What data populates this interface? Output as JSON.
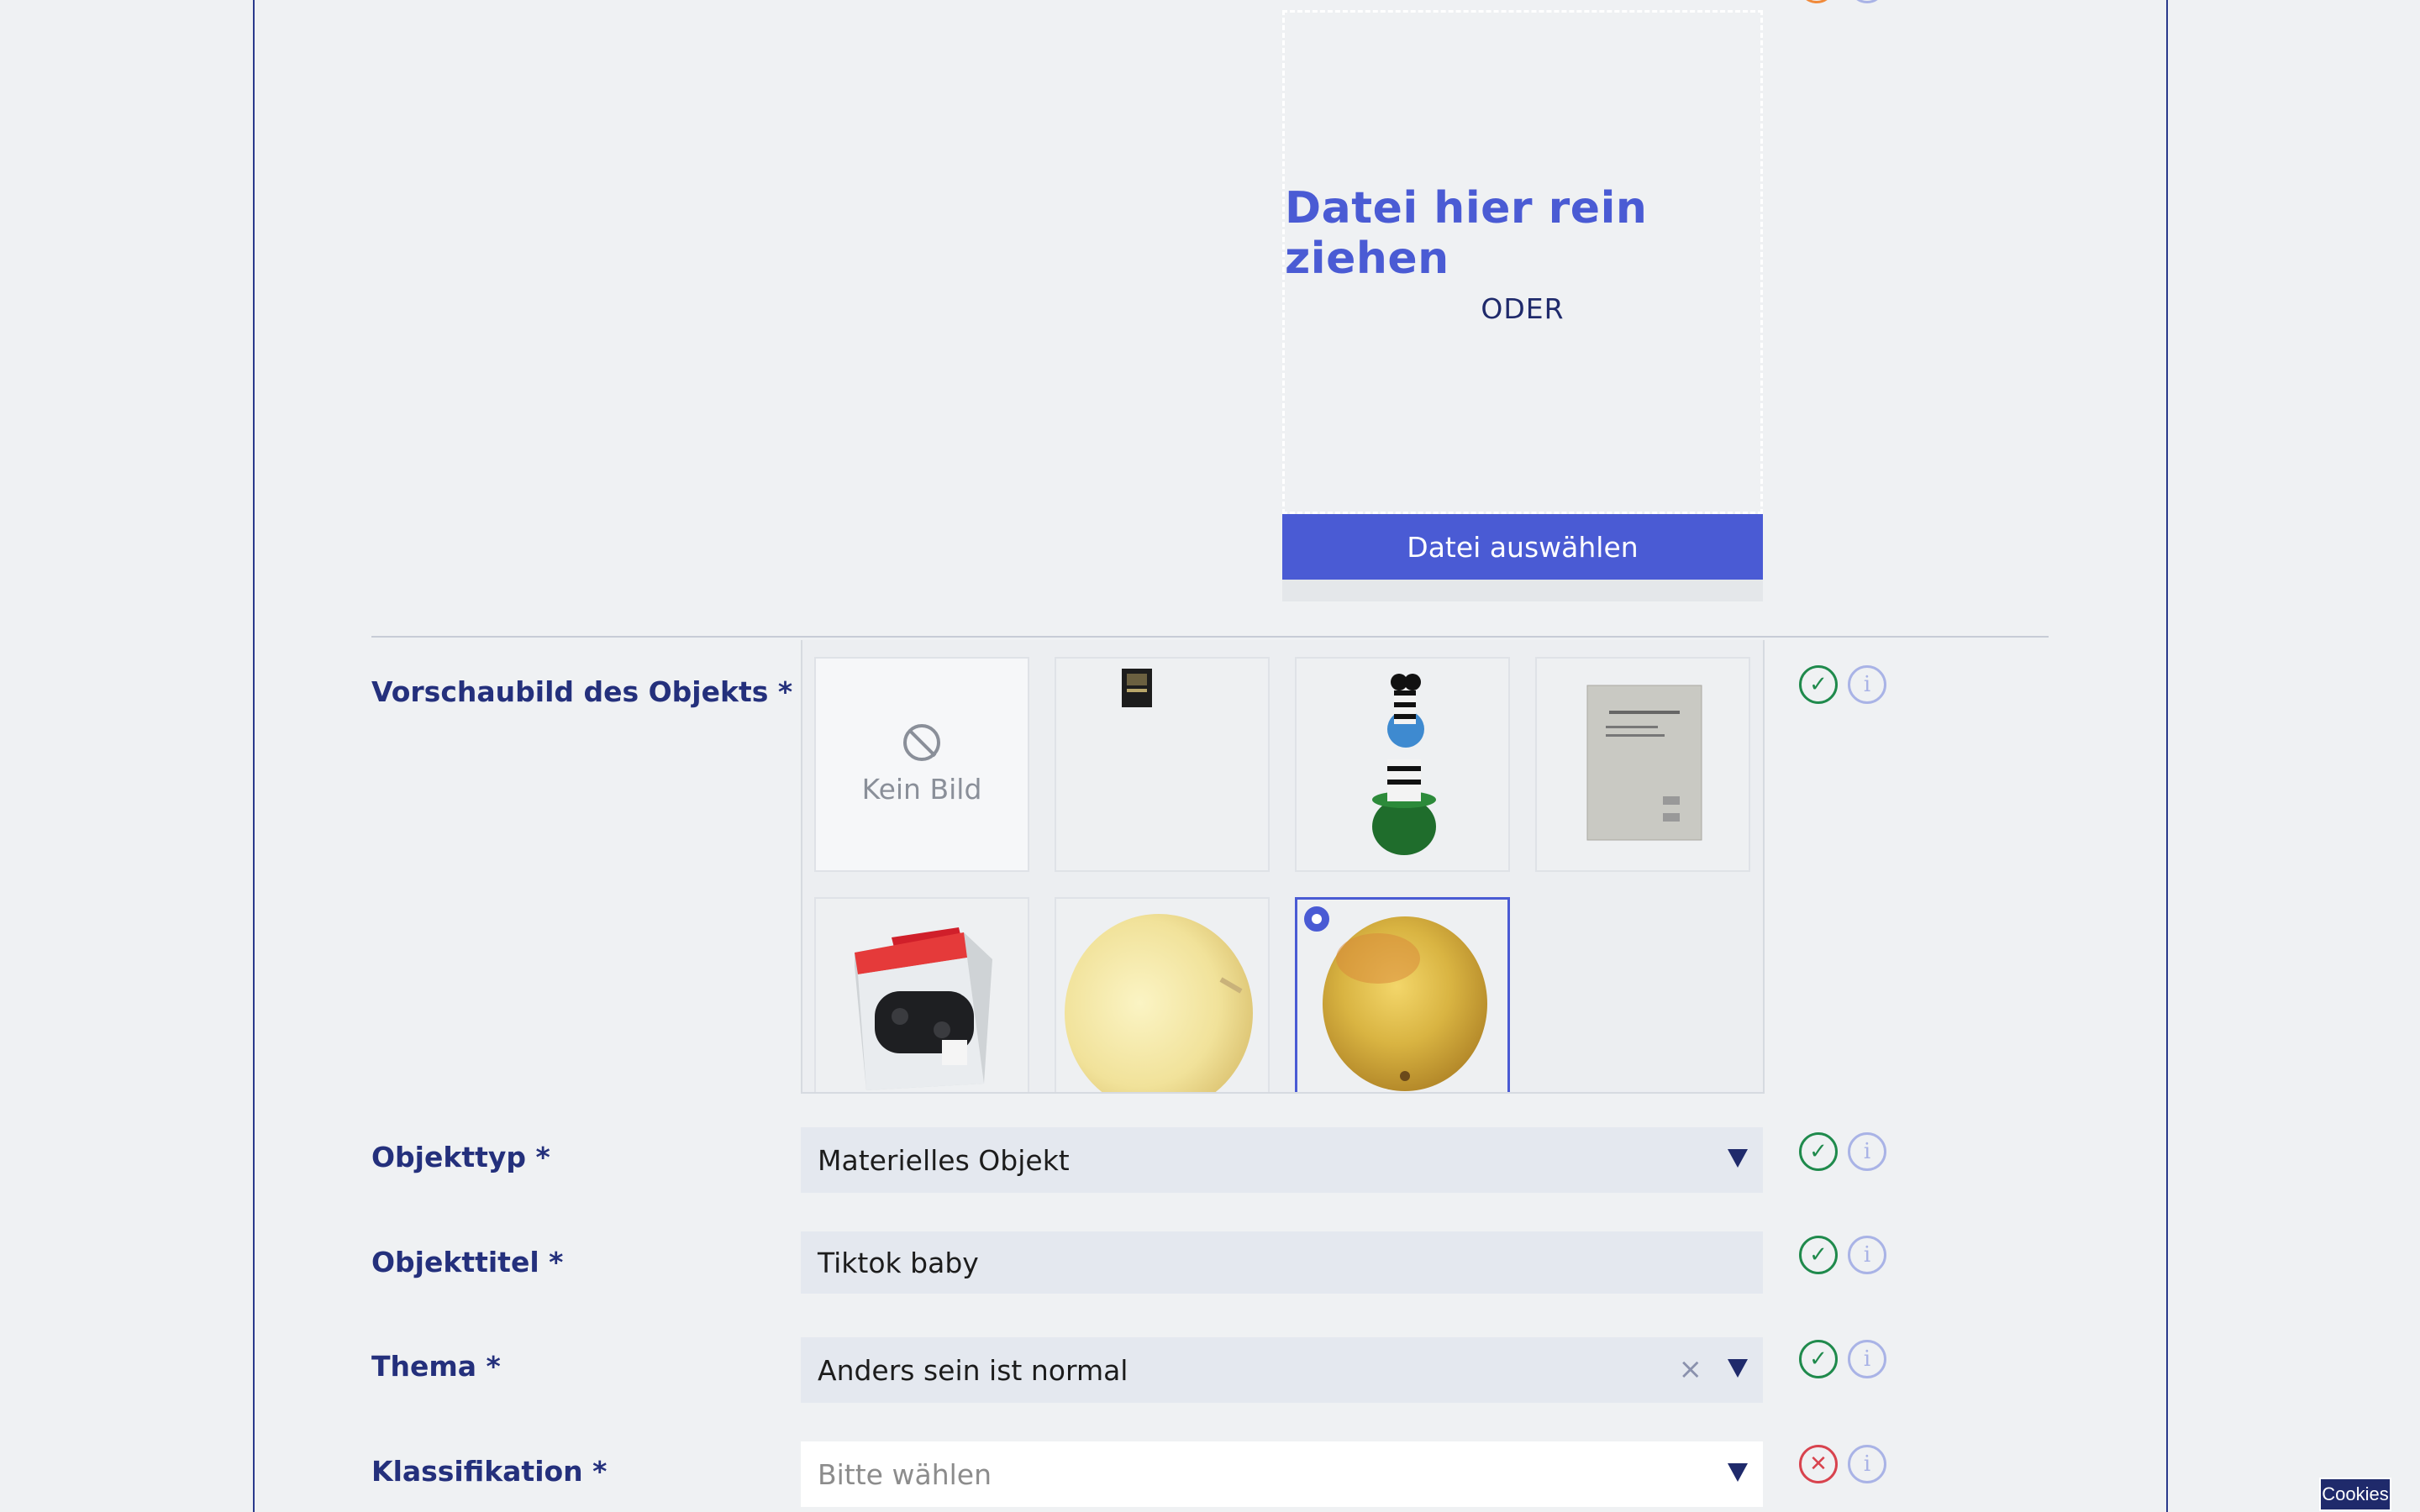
{
  "upload": {
    "drop_text": "Datei hier rein ziehen",
    "or_text": "ODER",
    "choose_button": "Datei auswählen"
  },
  "preview": {
    "label": "Vorschaubild des Objekts *",
    "none_label": "Kein Bild",
    "selected_index": 6,
    "status": "valid",
    "thumbnails": [
      {
        "name": "thumb-none",
        "kind": "none"
      },
      {
        "name": "thumb-small-book",
        "kind": "image"
      },
      {
        "name": "thumb-zebra-figure",
        "kind": "image"
      },
      {
        "name": "thumb-gray-book",
        "kind": "image"
      },
      {
        "name": "thumb-controller-box",
        "kind": "image"
      },
      {
        "name": "thumb-pale-apple",
        "kind": "image"
      },
      {
        "name": "thumb-apple",
        "kind": "image"
      }
    ]
  },
  "fields": {
    "type": {
      "label": "Objekttyp *",
      "value": "Materielles Objekt",
      "status": "valid"
    },
    "title": {
      "label": "Objekttitel *",
      "value": "Tiktok baby",
      "status": "valid"
    },
    "theme": {
      "label": "Thema *",
      "value": "Anders sein ist normal",
      "status": "valid"
    },
    "classification": {
      "label": "Klassifikation *",
      "placeholder": "Bitte wählen",
      "status": "invalid"
    }
  },
  "icons": {
    "valid": "check-circle-icon",
    "invalid": "x-circle-icon",
    "info": "info-icon",
    "clear": "clear-icon",
    "dropdown": "caret-down-icon"
  },
  "colors": {
    "accent": "#4a5bd4",
    "label": "#24307c",
    "valid": "#1f8a4c",
    "invalid": "#d8434e"
  },
  "cookies_button": "Cookies"
}
